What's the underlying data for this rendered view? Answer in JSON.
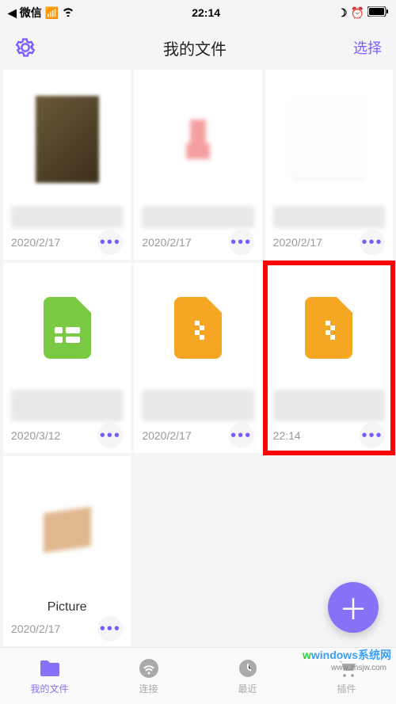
{
  "status": {
    "app": "微信",
    "time": "22:14"
  },
  "header": {
    "title": "我的文件",
    "select": "选择"
  },
  "files": [
    {
      "date": "2020/2/17"
    },
    {
      "date": "2020/2/17"
    },
    {
      "date": "2020/2/17"
    },
    {
      "date": "2020/3/12"
    },
    {
      "date": "2020/2/17"
    },
    {
      "date": "22:14"
    },
    {
      "date": "2020/2/17",
      "label": "Picture"
    }
  ],
  "tabs": [
    {
      "label": "我的文件"
    },
    {
      "label": "连接"
    },
    {
      "label": "最近"
    },
    {
      "label": "插件"
    }
  ],
  "watermark": {
    "brand": "windows系统网",
    "url": "www.znsjw.com"
  }
}
